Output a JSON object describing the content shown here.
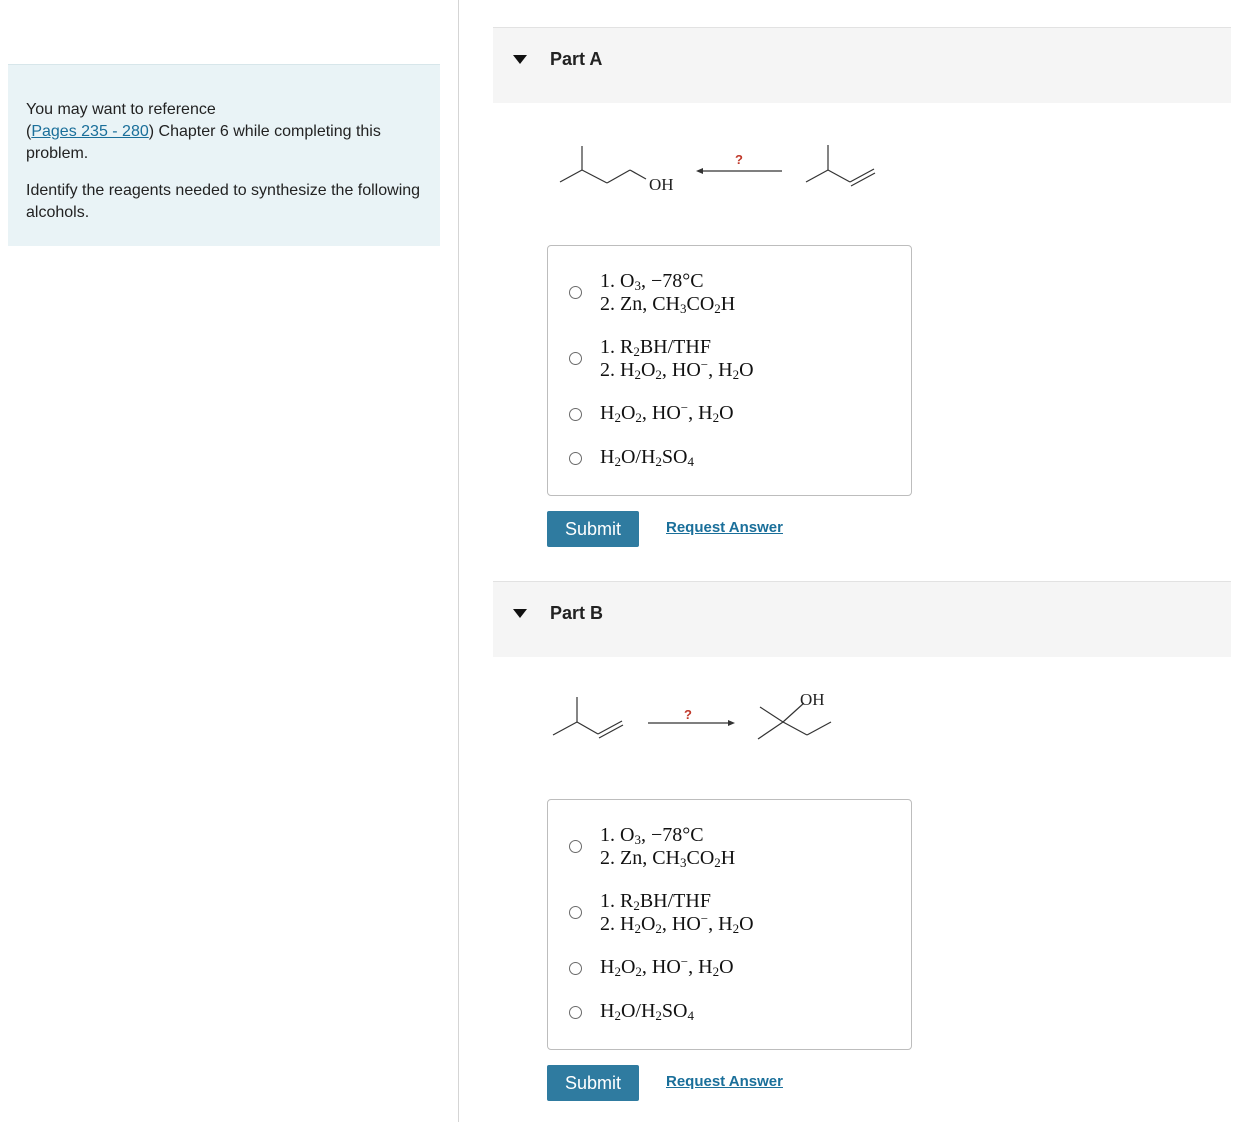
{
  "sidebar": {
    "reference_prefix": "You may want to reference",
    "open_paren": "(",
    "pages_link": "Pages 235 - 280",
    "reference_suffix": ") Chapter 6 while completing this problem.",
    "instructions": "Identify the reagents needed to synthesize the following alcohols."
  },
  "parts": [
    {
      "title": "Part A",
      "scheme": {
        "question_mark": "?",
        "product_label": "OH"
      },
      "options": [
        {
          "line1": "1. O",
          "line1_sub": "3",
          "line1_rest": ",  −78°C",
          "line2_pre": "2. Zn,  CH",
          "line2_sub1": "3",
          "line2_mid": "CO",
          "line2_sub2": "2",
          "line2_end": "H"
        },
        {
          "line1_pre": "1. R",
          "line1_sub": "2",
          "line1_rest": "BH/THF",
          "line2_pre": "2. H",
          "line2_sub1": "2",
          "line2_mid1": "O",
          "line2_sub2": "2",
          "line2_mid2": ",  HO",
          "line2_sup": "−",
          "line2_mid3": ",  H",
          "line2_sub3": "2",
          "line2_end": "O"
        },
        {
          "pre": "H",
          "sub1": "2",
          "mid1": "O",
          "sub2": "2",
          "mid2": ",  HO",
          "sup": "−",
          "mid3": ",  H",
          "sub3": "2",
          "end": "O"
        },
        {
          "pre": "H",
          "sub1": "2",
          "mid1": "O/H",
          "sub2": "2",
          "mid2": "SO",
          "sub3": "4"
        }
      ],
      "submit_label": "Submit",
      "request_label": "Request Answer"
    },
    {
      "title": "Part B",
      "scheme": {
        "question_mark": "?",
        "product_label": "OH"
      },
      "options": [
        {
          "line1": "1. O",
          "line1_sub": "3",
          "line1_rest": ",  −78°C",
          "line2_pre": "2. Zn,  CH",
          "line2_sub1": "3",
          "line2_mid": "CO",
          "line2_sub2": "2",
          "line2_end": "H"
        },
        {
          "line1_pre": "1. R",
          "line1_sub": "2",
          "line1_rest": "BH/THF",
          "line2_pre": "2. H",
          "line2_sub1": "2",
          "line2_mid1": "O",
          "line2_sub2": "2",
          "line2_mid2": ",  HO",
          "line2_sup": "−",
          "line2_mid3": ",  H",
          "line2_sub3": "2",
          "line2_end": "O"
        },
        {
          "pre": "H",
          "sub1": "2",
          "mid1": "O",
          "sub2": "2",
          "mid2": ",  HO",
          "sup": "−",
          "mid3": ",  H",
          "sub3": "2",
          "end": "O"
        },
        {
          "pre": "H",
          "sub1": "2",
          "mid1": "O/H",
          "sub2": "2",
          "mid2": "SO",
          "sub3": "4"
        }
      ],
      "submit_label": "Submit",
      "request_label": "Request Answer"
    }
  ],
  "colors": {
    "panel_bg": "#e9f3f6",
    "accent": "#2f7ba0",
    "link": "#1a6f9a",
    "question_mark": "#c0392b"
  }
}
